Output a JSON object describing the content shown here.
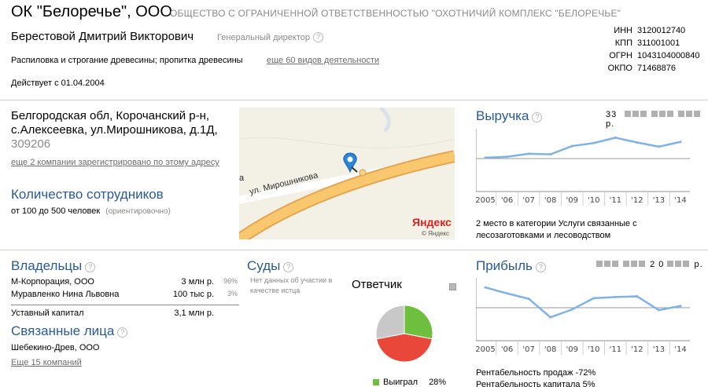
{
  "header": {
    "company_short": "ОК \"Белоречье\", ООО",
    "company_full": "ОБЩЕСТВО С ОГРАНИЧЕННОЙ ОТВЕТСТВЕННОСТЬЮ \"ОХОТНИЧИЙ КОМПЛЕКС \"БЕЛОРЕЧЬЕ\"",
    "director_name": "Берестовой Дмитрий Викторович",
    "director_role": "Генеральный директор",
    "activity": "Распиловка и строгание древесины; пропитка древесины",
    "activity_more": "еще 60 видов деятельности",
    "active_since": "Действует с 01.04.2004",
    "codes": [
      {
        "label": "ИНН",
        "value": "3120012740"
      },
      {
        "label": "КПП",
        "value": "311001001"
      },
      {
        "label": "ОГРН",
        "value": "1043104000840"
      },
      {
        "label": "ОКПО",
        "value": "71468876"
      }
    ]
  },
  "address": {
    "line1": "Белгородская обл, Корочанский р-н,",
    "line2": "с.Алексеевка, ул.Мирошникова, д.1Д,",
    "postcode": "309206",
    "more_link": "еще 2 компании зарегистрировано по этому адресу"
  },
  "map": {
    "street_label": "ул. Мирошникова",
    "edge_letter": "а",
    "brand": "Яндекс",
    "brand_small": "© Яндекс"
  },
  "employees": {
    "title": "Количество сотрудников",
    "value": "от 100 до 500 человек",
    "note": "(ориентировочно)"
  },
  "revenue": {
    "title": "Выручка",
    "amount_prefix": "33",
    "amount_suffix": "р.",
    "rank_text": "2 место в категории Услуги связанные с лесозаготовками и лесоводством"
  },
  "profit": {
    "title": "Прибыль",
    "amount_mid": "2 0",
    "amount_suffix": "р.",
    "margin_sales": "Рентабельность продаж -72%",
    "margin_capital": "Рентабельность капитала 5%"
  },
  "owners": {
    "title": "Владельцы",
    "rows": [
      {
        "name": "М-Корпорация, ООО",
        "amount": "3 млн р.",
        "share": "96%"
      },
      {
        "name": "Муравленко Нина Львовна",
        "amount": "100 тыс р.",
        "share": "3%"
      }
    ],
    "capital_label": "Уставный капитал",
    "capital_value": "3,1 млн р."
  },
  "related": {
    "title": "Связанные лица",
    "company": "Шебекино-Древ, ООО",
    "more": "Еще 15 компаний"
  },
  "courts": {
    "title": "Суды",
    "note": "Нет данных об участии в качестве истца",
    "defendant_title": "Ответчик",
    "legend_label": "Выиграл",
    "legend_value": "28%"
  },
  "colors": {
    "accent_blue": "#2a5a94",
    "chart_line": "#7fb3e8",
    "won": "#6fbf3f",
    "lost": "#e8473a",
    "neutral": "#c8c8c8"
  },
  "chart_data": [
    {
      "type": "line",
      "title": "Выручка",
      "categories": [
        "2005",
        "'06",
        "'07",
        "'08",
        "'09",
        "'10",
        "'11",
        "'12",
        "'13",
        "'14"
      ],
      "series": [
        {
          "values": [
            0.3,
            0.6,
            1.6,
            1.4,
            4.2,
            5.2,
            7.0,
            5.4,
            4.0,
            5.6
          ]
        }
      ],
      "ylim": [
        -10,
        10
      ]
    },
    {
      "type": "line",
      "title": "Прибыль",
      "categories": [
        "2005",
        "'06",
        "'07",
        "'08",
        "'09",
        "'10",
        "'11",
        "'12",
        "'13",
        "'14"
      ],
      "series": [
        {
          "values": [
            6.8,
            4.8,
            3.0,
            -3.2,
            -0.6,
            3.2,
            3.6,
            3.8,
            -0.8,
            0.6
          ]
        }
      ],
      "ylim": [
        -10,
        10
      ]
    },
    {
      "type": "pie",
      "title": "Ответчик",
      "slices": [
        {
          "label": "Выиграл",
          "value": 28
        },
        {
          "value": 44
        },
        {
          "value": 28
        }
      ]
    }
  ]
}
